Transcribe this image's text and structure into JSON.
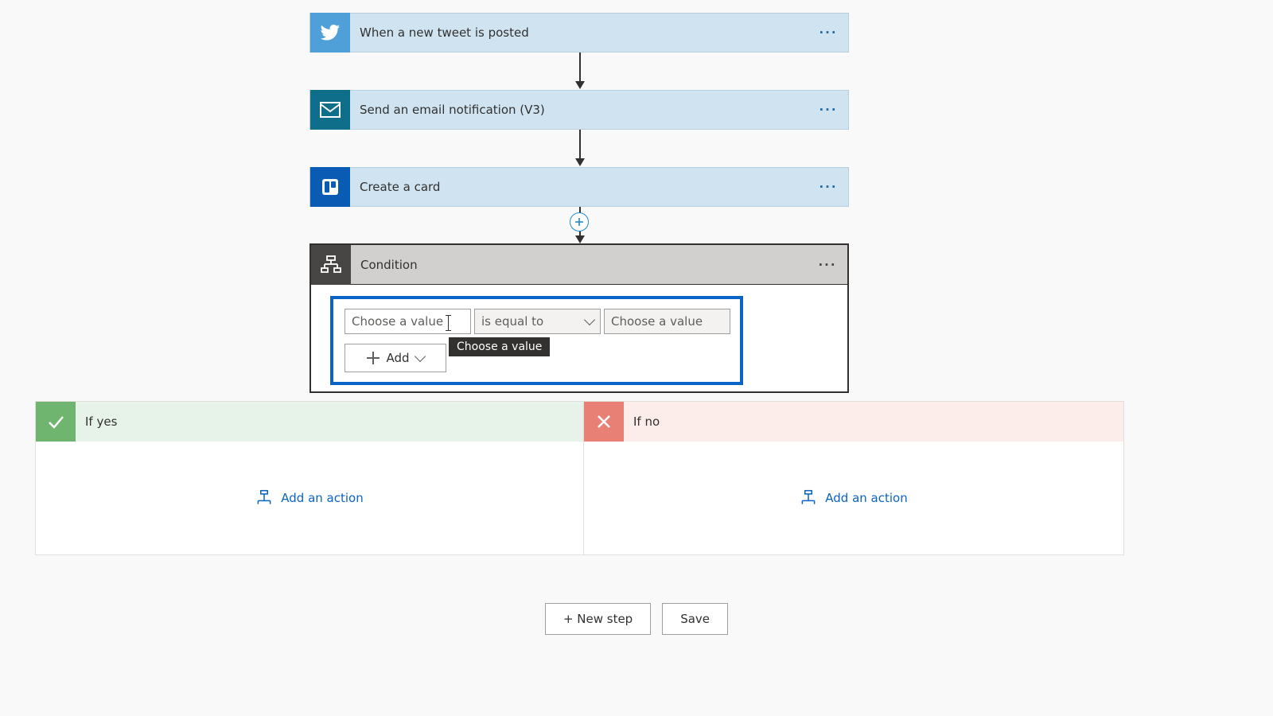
{
  "steps": {
    "tweet": {
      "label": "When a new tweet is posted",
      "icon": "twitter-icon",
      "icon_bg": "#4f9fd8"
    },
    "email": {
      "label": "Send an email notification (V3)",
      "icon": "mail-icon",
      "icon_bg": "#0f6f8b"
    },
    "trello": {
      "label": "Create a card",
      "icon": "trello-icon",
      "icon_bg": "#0a5bb3"
    }
  },
  "condition": {
    "title": "Condition",
    "left_placeholder": "Choose a value",
    "operator": "is equal to",
    "right_placeholder": "Choose a value",
    "add_label": "Add",
    "tooltip": "Choose a value"
  },
  "branches": {
    "yes": {
      "title": "If yes",
      "add_action": "Add an action"
    },
    "no": {
      "title": "If no",
      "add_action": "Add an action"
    }
  },
  "footer": {
    "new_step": "+ New step",
    "save": "Save"
  }
}
